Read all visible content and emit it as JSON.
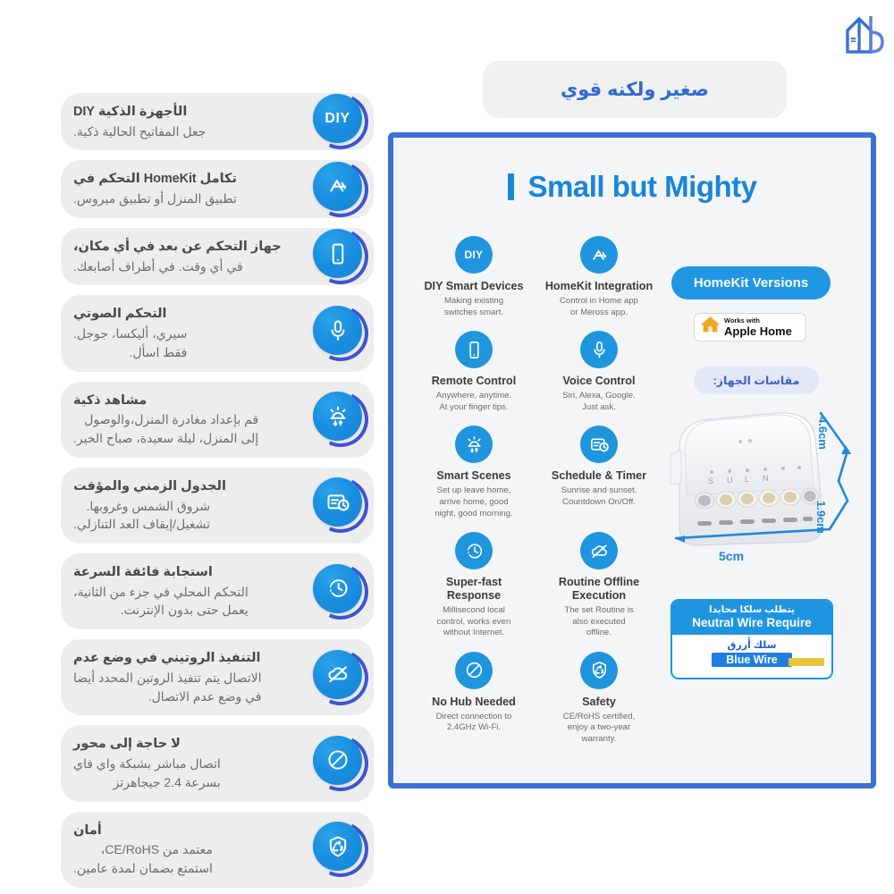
{
  "brand": {
    "logo_name": "m-house-logo",
    "color": "#3d6fd8"
  },
  "header": {
    "arabic_tagline": "صغير ولكنه قوي",
    "panel_title": "Small but Mighty"
  },
  "colors": {
    "panel_border": "#3d6fd8",
    "icon_blue": "#1e95dd",
    "accent_blue": "#1986d8",
    "ring_blue": "#3f54d1",
    "card_bg": "#ededed"
  },
  "sidebar": {
    "items": [
      {
        "icon": "diy-icon",
        "title": "الأجهزة الذكية DIY",
        "desc": "جعل المفاتيح الحالية ذكية."
      },
      {
        "icon": "appstore-icon",
        "title": "تكامل HomeKit التحكم في",
        "desc": "تطبيق المنزل أو تطبيق ميروس."
      },
      {
        "icon": "phone-icon",
        "title": "جهاز التحكم عن بعد في أي مكان،",
        "desc": "في أي وقت. في أطراف أصابعك."
      },
      {
        "icon": "mic-icon",
        "title": "التحكم الصوتي",
        "desc": "سيري، أليكسا، جوجل.\nفقط اسأل."
      },
      {
        "icon": "scene-icon",
        "title": "مشاهد ذكية",
        "desc": "قم بإعداد مغادرة المنزل،والوصول\nإلى المنزل، ليلة سعيدة، صباح الخير."
      },
      {
        "icon": "schedule-icon",
        "title": "الجدول الزمني والمؤقت",
        "desc": "شروق الشمس وغروبها.\nتشغيل/إيقاف العد التنازلي."
      },
      {
        "icon": "fast-icon",
        "title": "استجابة فائقة السرعة",
        "desc": "التحكم المحلي في جزء من الثانية،\nيعمل حتى بدون الإنترنت."
      },
      {
        "icon": "offline-icon",
        "title": "التنفيذ الروتيني في وضع عدم",
        "desc": "الاتصال يتم تنفيذ الروتين المحدد أيضا\nفي وضع عدم الاتصال."
      },
      {
        "icon": "nohub-icon",
        "title": "لا حاجة إلى محور",
        "desc": "اتصال مباشر بشبكة واي فاي\nبسرعة 2.4 جيجاهرتز"
      },
      {
        "icon": "safety-icon",
        "title": "أمان",
        "desc": "معتمد من CE/RoHS،\nاستمتع بضمان لمدة عامين."
      }
    ]
  },
  "panel": {
    "features": [
      {
        "icon": "diy-icon",
        "title": "DIY Smart Devices",
        "desc": "Making existing\nswitches smart."
      },
      {
        "icon": "appstore-icon",
        "title": "HomeKit Integration",
        "desc": "Control in Home app\nor Meross app."
      },
      {
        "icon": "phone-icon",
        "title": "Remote Control",
        "desc": "Anywhere, anytime.\nAt your finger tips."
      },
      {
        "icon": "mic-icon",
        "title": "Voice Control",
        "desc": "Siri, Alexa, Google.\nJust ask."
      },
      {
        "icon": "scene-icon",
        "title": "Smart Scenes",
        "desc": "Set up leave home,\narrive home, good\nnight, good morning."
      },
      {
        "icon": "schedule-icon",
        "title": "Schedule & Timer",
        "desc": "Sunrise and sunset.\nCountdown On/Off."
      },
      {
        "icon": "fast-icon",
        "title": "Super-fast\nResponse",
        "desc": "Millisecond local\ncontrol, works even\nwithout Internet."
      },
      {
        "icon": "offline-icon",
        "title": "Routine Offline\nExecution",
        "desc": "The set Routine is\nalso executed\noffline."
      },
      {
        "icon": "nohub-icon",
        "title": "No Hub Needed",
        "desc": "Direct connection to\n2.4GHz Wi-Fi."
      },
      {
        "icon": "safety-icon",
        "title": "Safety",
        "desc": "CE/RoHS certified,\nenjoy a two-year\nwarranty."
      }
    ],
    "homekit_pill": "HomeKit Versions",
    "apple_badge": {
      "line1": "Works with",
      "line2": "Apple Home",
      "icon": "apple-home-icon"
    },
    "dimensions_pill": "مقاسات الجهاز:",
    "device": {
      "height_label": "4.6cm",
      "depth_label": "1.9cm",
      "width_label": "5cm",
      "terminal_labels": "S U L N"
    },
    "neutral_wire": {
      "arabic_head": "يتطلب سلكا محايدا",
      "english_head": "Neutral Wire Require",
      "arabic_blue": "سلك أَزرق",
      "english_blue": "Blue Wire"
    }
  }
}
